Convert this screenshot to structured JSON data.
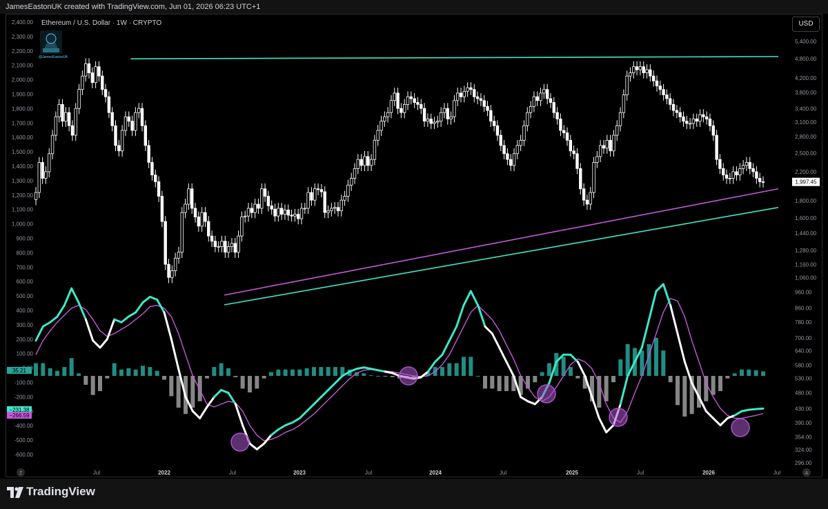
{
  "header": {
    "attribution": "JamesEastonUK created with TradingView.com, Jun 01, 2026 06:23 UTC+1"
  },
  "chart_title": "Ethereum / U.S. Dollar · 1W · CRYPTO",
  "author_handle": "@JamesEastonUK",
  "currency_button": "USD",
  "footer": {
    "brand": "TradingView"
  },
  "colors": {
    "background": "#000000",
    "cyan": "#3ee8c8",
    "magenta": "#c45ad8",
    "candle": "#ffffff",
    "hist_positive": "#26a69a",
    "hist_negative": "#9e9e9e",
    "circle": "#a855c8"
  },
  "chart_data": [
    {
      "type": "candlestick",
      "title": "Ethereum / U.S. Dollar · 1W · CRYPTO",
      "x_ticks": [
        "Jul",
        "2022",
        "Jul",
        "2023",
        "Jul",
        "2024",
        "Jul",
        "2025",
        "Jul",
        "2026",
        "Jul"
      ],
      "left_axis_ticks": [
        "2,400.00",
        "2,300.00",
        "2,200.00",
        "2,100.00",
        "2,000.00",
        "1,900.00",
        "1,800.00",
        "1,700.00",
        "1,600.00",
        "1,500.00",
        "1,400.00",
        "1,300.00",
        "1,200.00",
        "1,100.00",
        "1,000.00",
        "900.00",
        "800.00",
        "700.00",
        "600.00",
        "500.00",
        "400.00",
        "300.00",
        "200.00",
        "100.00",
        "0.00",
        "-100.00",
        "-200.00",
        "-300.00",
        "-400.00",
        "-500.00",
        "-600.00"
      ],
      "right_axis_ticks": [
        "5,400.00",
        "4,800.00",
        "4,200.00",
        "3,800.00",
        "3,400.00",
        "3,100.00",
        "2,800.00",
        "2,500.00",
        "2,200.00",
        "1,800.00",
        "1,600.00",
        "1,440.00",
        "1,280.00",
        "1,160.00",
        "1,060.00",
        "960.00",
        "860.00",
        "780.00",
        "700.00",
        "640.00",
        "580.00",
        "530.00",
        "480.00",
        "430.00",
        "390.00",
        "354.00",
        "324.00",
        "296.00"
      ],
      "right_axis_scale": "log",
      "last_price_label": "1,997.45",
      "weekly_closes": [
        1850,
        2300,
        2050,
        2150,
        2450,
        2800,
        3200,
        3500,
        3100,
        3300,
        3000,
        2800,
        3400,
        3900,
        4300,
        4700,
        4400,
        4100,
        4600,
        4300,
        3900,
        3700,
        3300,
        3000,
        2600,
        2500,
        2900,
        3200,
        3100,
        2900,
        3300,
        3400,
        3000,
        2600,
        2300,
        2100,
        2000,
        1800,
        1500,
        1100,
        1000,
        1050,
        1150,
        1200,
        1600,
        1700,
        1900,
        1650,
        1550,
        1450,
        1600,
        1500,
        1350,
        1300,
        1250,
        1250,
        1300,
        1200,
        1250,
        1280,
        1200,
        1350,
        1550,
        1560,
        1650,
        1600,
        1700,
        1650,
        1900,
        1800,
        1680,
        1640,
        1560,
        1650,
        1580,
        1630,
        1570,
        1560,
        1580,
        1530,
        1650,
        1650,
        1850,
        1750,
        1900,
        1890,
        1860,
        1600,
        1620,
        1650,
        1660,
        1620,
        1750,
        1800,
        1950,
        2050,
        2200,
        2350,
        2250,
        2400,
        2250,
        2350,
        2700,
        2900,
        3100,
        3200,
        3300,
        3600,
        3800,
        3400,
        3300,
        3500,
        3700,
        3650,
        3550,
        3500,
        3400,
        3100,
        3150,
        3050,
        3080,
        3100,
        3300,
        3400,
        3150,
        3200,
        3600,
        3800,
        3700,
        3850,
        3950,
        3900,
        3700,
        3650,
        3600,
        3450,
        3350,
        3100,
        3000,
        2800,
        2600,
        2450,
        2350,
        2250,
        2450,
        2600,
        2700,
        3000,
        3300,
        3450,
        3700,
        3600,
        3800,
        3900,
        3650,
        3550,
        3300,
        3150,
        2900,
        2850,
        2700,
        2500,
        2450,
        2200,
        1900,
        1750,
        1700,
        1850,
        2300,
        2400,
        2600,
        2550,
        2700,
        2500,
        2800,
        3000,
        3300,
        3750,
        4300,
        4400,
        4600,
        4500,
        4600,
        4400,
        4500,
        4300,
        4150,
        4000,
        3900,
        3750,
        3650,
        3500,
        3350,
        3300,
        3200,
        3100,
        3050,
        3050,
        3150,
        3100,
        3250,
        3200,
        3150,
        3000,
        2800,
        2350,
        2200,
        2100,
        2050,
        2050,
        2150,
        2100,
        2200,
        2250,
        2300,
        2200,
        2150,
        2050,
        2000,
        1997.45
      ],
      "trendlines": [
        {
          "name": "upper resistance (cyan)",
          "from": {
            "date": "2021-11",
            "price": 4870
          },
          "to": {
            "date": "2026-06",
            "price": 4950
          }
        },
        {
          "name": "inner support (magenta)",
          "from": {
            "date": "2022-06",
            "price": 880
          },
          "to": {
            "date": "2026-06",
            "price": 1900
          }
        },
        {
          "name": "lower support (cyan)",
          "from": {
            "date": "2022-06",
            "price": 820
          },
          "to": {
            "date": "2026-06",
            "price": 1660
          }
        }
      ]
    },
    {
      "type": "macd",
      "series": [
        {
          "name": "MACD",
          "label": "−231.38"
        },
        {
          "name": "Signal",
          "label": "−266.59"
        },
        {
          "name": "Histogram",
          "label": "35.21"
        }
      ],
      "macd_line": [
        250,
        350,
        380,
        420,
        500,
        620,
        520,
        400,
        250,
        200,
        260,
        400,
        380,
        420,
        450,
        520,
        560,
        540,
        450,
        260,
        50,
        -150,
        -250,
        -300,
        -220,
        -150,
        -100,
        -120,
        -200,
        -350,
        -480,
        -520,
        -480,
        -420,
        -380,
        -350,
        -330,
        -300,
        -250,
        -200,
        -150,
        -100,
        -50,
        0,
        30,
        50,
        60,
        50,
        40,
        30,
        20,
        0,
        -10,
        -20,
        -10,
        30,
        100,
        150,
        250,
        350,
        500,
        600,
        500,
        350,
        300,
        200,
        100,
        0,
        -150,
        -180,
        -200,
        -150,
        -50,
        100,
        150,
        150,
        100,
        0,
        -150,
        -300,
        -400,
        -350,
        -200,
        0,
        100,
        200,
        400,
        600,
        650,
        500,
        300,
        100,
        -50,
        -150,
        -250,
        -300,
        -350,
        -300,
        -280,
        -250,
        -240,
        -235,
        -231.38
      ],
      "signal_line": [
        150,
        250,
        320,
        380,
        430,
        480,
        500,
        470,
        400,
        320,
        280,
        300,
        330,
        360,
        400,
        440,
        490,
        500,
        480,
        420,
        300,
        150,
        0,
        -100,
        -200,
        -220,
        -200,
        -180,
        -190,
        -250,
        -350,
        -420,
        -460,
        -450,
        -430,
        -400,
        -380,
        -350,
        -310,
        -270,
        -220,
        -170,
        -120,
        -70,
        -20,
        20,
        40,
        45,
        40,
        35,
        30,
        20,
        10,
        0,
        -5,
        0,
        30,
        80,
        150,
        250,
        350,
        450,
        500,
        450,
        400,
        320,
        220,
        120,
        0,
        -80,
        -150,
        -180,
        -150,
        -80,
        0,
        80,
        120,
        100,
        50,
        -50,
        -200,
        -300,
        -330,
        -250,
        -120,
        0,
        150,
        300,
        450,
        550,
        530,
        420,
        250,
        100,
        -50,
        -150,
        -230,
        -280,
        -300,
        -300,
        -290,
        -280,
        -266.59
      ],
      "circled_crossovers": [
        "2022-08",
        "2023-11",
        "2024-10",
        "2025-05",
        "2026-03"
      ],
      "ylim": [
        -600,
        700
      ]
    }
  ]
}
